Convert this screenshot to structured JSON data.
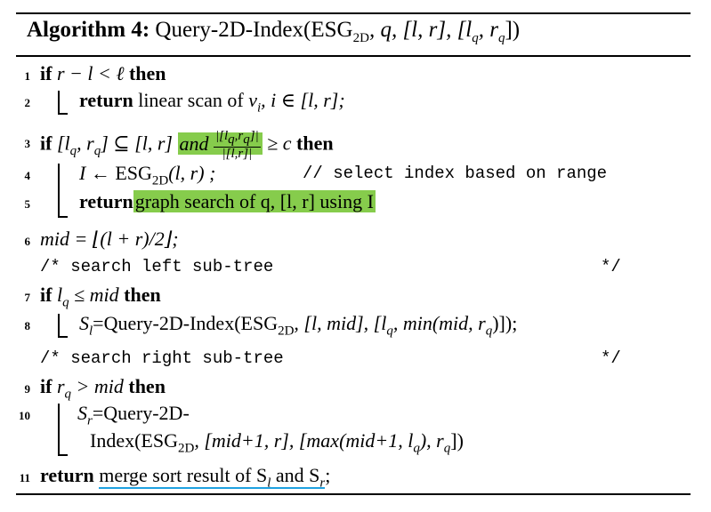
{
  "algorithm": {
    "label": "Algorithm 4:",
    "name": "Query-2D-Index",
    "params": "(ESG",
    "params_sub": "2D",
    "params_rest": ", q, [l, r], [l",
    "params_sub2": "q",
    "params_rest2": ", r",
    "params_sub3": "q",
    "params_end": "])"
  },
  "lines": [
    {
      "no": "1"
    },
    {
      "no": "2"
    },
    {
      "no": "3"
    },
    {
      "no": "4"
    },
    {
      "no": "5"
    },
    {
      "no": "6"
    },
    {
      "no": "7"
    },
    {
      "no": "8"
    },
    {
      "no": "9"
    },
    {
      "no": "10"
    },
    {
      "no": "11"
    }
  ],
  "text": {
    "if": "if",
    "then": "then",
    "return": "return",
    "l1_cond": "r − l < ℓ",
    "l2_body": "linear scan of ",
    "l2_v": "v",
    "l2_vsub": "i",
    "l2_rest": ", i ∈ [l, r];",
    "l3_cond": "[l",
    "l3_q": "q",
    "l3_mid": ", r",
    "l3_q2": "q",
    "l3_sub": "] ⊆ [l, r]",
    "l3_and": "and",
    "l3_num": "|[l",
    "l3_numq": "q",
    "l3_numr": ",r",
    "l3_numq2": "q",
    "l3_numend": "]|",
    "l3_den": "|[l,r]|",
    "l3_ge": " ≥ c",
    "l4_I": "I",
    "l4_assign": " ← ESG",
    "l4_sub": "2D",
    "l4_args": "(l, r) ;",
    "l4_comment": "// select index based on range",
    "l5_body": "graph search of q, [l, r] using I",
    "l6_body": "mid = ⌊(l + r)/2⌋;",
    "c1_open": "/* search left sub-tree",
    "c_close": "*/",
    "l7_cond": "l",
    "l7_q": "q",
    "l7_rest": " ≤ mid",
    "l8_S": "S",
    "l8_Ssub": "l",
    "l8_call": "=Query-2D-Index(ESG",
    "l8_sub": "2D",
    "l8_args": ", [l, mid], [l",
    "l8_q": "q",
    "l8_min": ", min(mid, r",
    "l8_q2": "q",
    "l8_end": ")]);",
    "c2_open": "/* search right sub-tree",
    "l9_cond": "r",
    "l9_q": "q",
    "l9_rest": " > mid",
    "l10a_S": "S",
    "l10a_sub": "r",
    "l10a_call": "=Query-2D-",
    "l10b_call": "Index(ESG",
    "l10b_sub": "2D",
    "l10b_args": ", [mid+1, r], [max(mid+1, l",
    "l10b_q": "q",
    "l10b_mid": "), r",
    "l10b_q2": "q",
    "l10b_end": "])",
    "l11_body": "merge sort result of S",
    "l11_sub1": "l",
    "l11_and": " and S",
    "l11_sub2": "r",
    "l11_end": ";"
  },
  "colors": {
    "highlight": "#86cc4c",
    "underline": "#1ea1e0"
  }
}
